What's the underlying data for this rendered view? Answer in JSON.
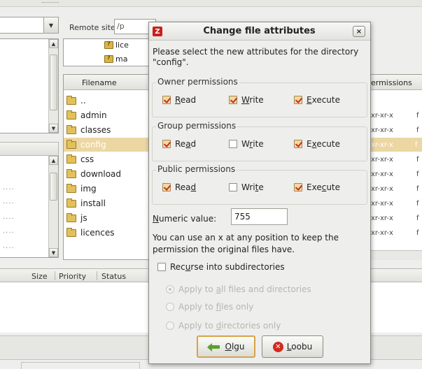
{
  "background": {
    "remote_site_label": "Remote site:",
    "remote_site_value": "/p",
    "remote_tree_items": [
      "lice",
      "ma"
    ],
    "remote_list_header": "Filename",
    "remote_files": [
      "..",
      "admin",
      "classes",
      "config",
      "css",
      "download",
      "img",
      "install",
      "js",
      "licences"
    ],
    "permissions_header": "ermissions",
    "owner_header": "f",
    "permission_values": [
      "",
      "",
      "xr-xr-x",
      "xr-xr-x",
      "xr-xr-x",
      "xr-xr-x",
      "xr-xr-x",
      "xr-xr-x",
      "xr-xr-x",
      "xr-xr-x"
    ],
    "queue_columns": [
      "Size",
      "Priority",
      "Status"
    ],
    "left_dots": "...."
  },
  "dialog": {
    "title": "Change file attributes",
    "close_label": "×",
    "app_icon_letter": "Z",
    "intro": "Please select the new attributes for the directory \"config\".",
    "groups": [
      {
        "label": "Owner permissions",
        "read": {
          "pre": "",
          "acc": "R",
          "post": "ead",
          "checked": true
        },
        "write": {
          "pre": "",
          "acc": "W",
          "post": "rite",
          "checked": true
        },
        "execute": {
          "pre": "",
          "acc": "E",
          "post": "xecute",
          "checked": true
        }
      },
      {
        "label": "Group permissions",
        "read": {
          "pre": "Re",
          "acc": "a",
          "post": "d",
          "checked": true
        },
        "write": {
          "pre": "W",
          "acc": "r",
          "post": "ite",
          "checked": false
        },
        "execute": {
          "pre": "E",
          "acc": "x",
          "post": "ecute",
          "checked": true
        }
      },
      {
        "label": "Public permissions",
        "read": {
          "pre": "Rea",
          "acc": "d",
          "post": "",
          "checked": true
        },
        "write": {
          "pre": "Wri",
          "acc": "t",
          "post": "e",
          "checked": false
        },
        "execute": {
          "pre": "Exe",
          "acc": "c",
          "post": "ute",
          "checked": true
        }
      }
    ],
    "numeric_label_acc": "N",
    "numeric_label_rest": "umeric value:",
    "numeric_value": "755",
    "hint": "You can use an x at any position to keep the permission the original files have.",
    "recurse": {
      "pre": "Rec",
      "acc": "u",
      "post": "rse into subdirectories",
      "checked": false
    },
    "apply_options": [
      {
        "pre": "Apply to ",
        "acc": "a",
        "post": "ll files and directories",
        "selected": true
      },
      {
        "pre": "Apply to ",
        "acc": "f",
        "post": "iles only",
        "selected": false
      },
      {
        "pre": "Apply to ",
        "acc": "d",
        "post": "irectories only",
        "selected": false
      }
    ],
    "ok_acc": "O",
    "ok_rest": "lgu",
    "cancel_acc": "L",
    "cancel_rest": "oobu"
  }
}
